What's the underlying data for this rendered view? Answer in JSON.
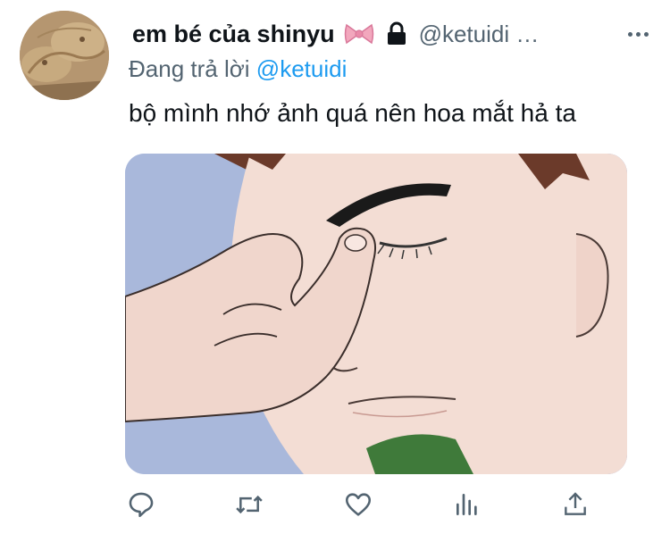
{
  "tweet": {
    "display_name": "em bé của shinyu",
    "handle": "@ketuidi …",
    "reply_prefix": "Đang trả lời",
    "reply_to": "@ketuidi",
    "text": "bộ mình nhớ ảnh quá nên hoa mắt hả ta"
  },
  "icons": {
    "name_badges": [
      "ribbon-bow-icon",
      "lock-icon"
    ],
    "more": "more-dots-icon",
    "actions": [
      "reply-icon",
      "retweet-icon",
      "like-icon",
      "analytics-icon",
      "share-icon"
    ]
  },
  "colors": {
    "text": "#0f1419",
    "secondary": "#536471",
    "mention": "#1d9bf0",
    "bow": "#f2a7bd"
  }
}
